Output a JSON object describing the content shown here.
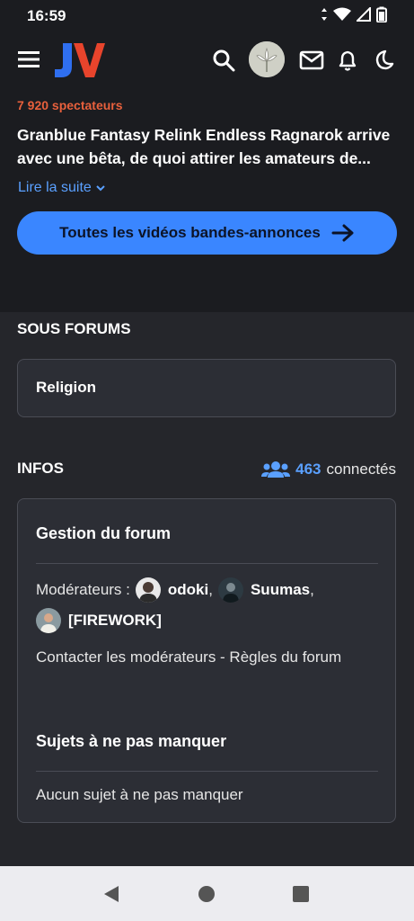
{
  "status": {
    "time": "16:59"
  },
  "video": {
    "spectators": "7 920 spectateurs",
    "title": "Granblue Fantasy Relink Endless Ragnarok arrive avec une bêta, de quoi attirer les amateurs de...",
    "read_more": "Lire la suite",
    "cta": "Toutes les vidéos bandes-annonces"
  },
  "subforums": {
    "title": "SOUS FORUMS",
    "items": [
      {
        "label": "Religion"
      }
    ]
  },
  "infos": {
    "title": "INFOS",
    "connected_count": "463",
    "connected_label": "connectés",
    "management_title": "Gestion du forum",
    "moderators_label": "Modérateurs :",
    "moderators": [
      {
        "name": "odoki",
        "sep": ","
      },
      {
        "name": "Suumas",
        "sep": ","
      },
      {
        "name": "[FIREWORK]",
        "sep": ""
      }
    ],
    "contact_text": "Contacter les modérateurs - Règles du forum",
    "must_read_title": "Sujets à ne pas manquer",
    "must_read_empty": "Aucun sujet à ne pas manquer"
  },
  "colors": {
    "accent_blue": "#3a86ff",
    "link_blue": "#5aa0ff",
    "spectators_orange": "#e8603c",
    "background": "#25262b"
  }
}
